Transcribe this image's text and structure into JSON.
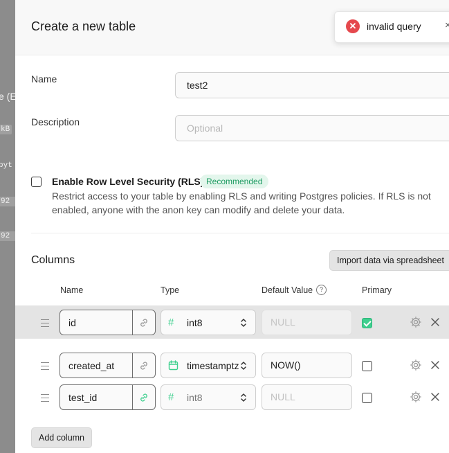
{
  "background_fragments": [
    "e (E",
    "kB",
    "pyt",
    "92 k",
    "92 k"
  ],
  "panel": {
    "title": "Create a new table"
  },
  "toast": {
    "message": "invalid query",
    "icon": "error-circle-icon",
    "close_glyph": "×"
  },
  "form": {
    "name_label": "Name",
    "name_value": "test2",
    "description_label": "Description",
    "description_placeholder": "Optional"
  },
  "rls": {
    "title": "Enable Row Level Security (RLS)",
    "badge": "Recommended",
    "description": "Restrict access to your table by enabling RLS and writing Postgres policies. If RLS is not enabled, anyone with the anon key can modify and delete your data.",
    "checked": false
  },
  "columns": {
    "title": "Columns",
    "import_button": "Import data via spreadsheet",
    "headers": {
      "name": "Name",
      "type": "Type",
      "default_value": "Default Value",
      "primary": "Primary"
    },
    "rows": [
      {
        "name": "id",
        "type": "int8",
        "type_icon": "hash-icon",
        "default": "NULL",
        "primary": true
      },
      {
        "name": "created_at",
        "type": "timestamptz",
        "type_icon": "calendar-icon",
        "default": "NOW()",
        "primary": false
      },
      {
        "name": "test_id",
        "type": "int8",
        "type_icon": "hash-icon",
        "default": "NULL",
        "primary": false
      }
    ],
    "add_button": "Add column"
  },
  "colors": {
    "accent": "#3ecf8e",
    "error": "#e5484d",
    "highlight_row": "#e4e4e4"
  }
}
